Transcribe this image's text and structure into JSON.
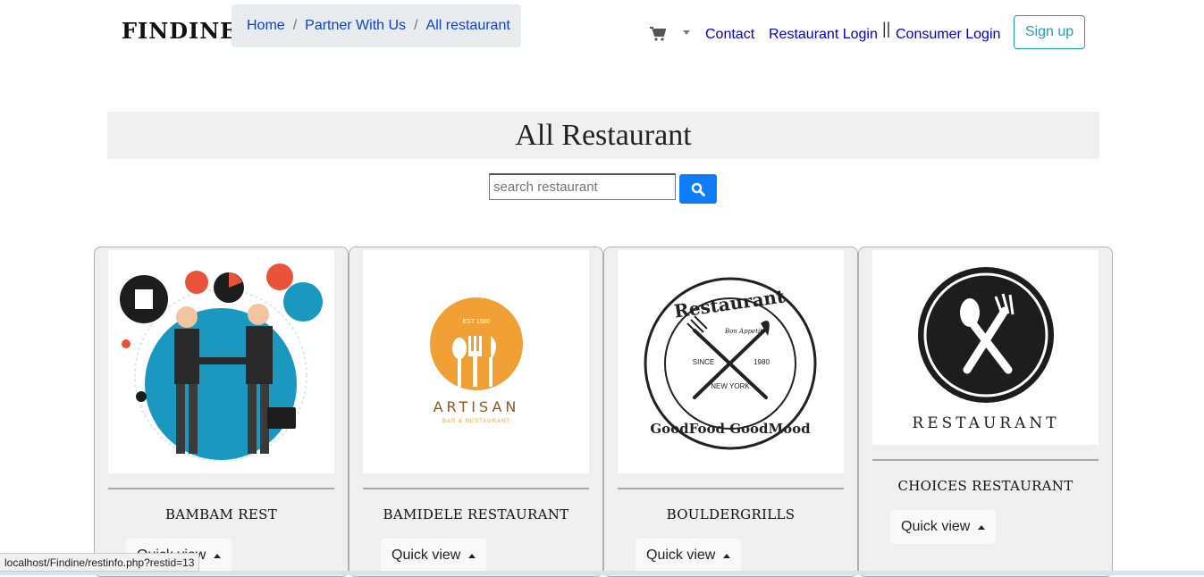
{
  "brand": "FINDINE",
  "breadcrumb": [
    "Home",
    "Partner With Us",
    "All restaurant"
  ],
  "nav": {
    "contact": "Contact",
    "restaurant_login": "Restaurant Login",
    "separator": "||",
    "consumer_login": "Consumer Login",
    "signup": "Sign up",
    "cart_icon": "cart-icon"
  },
  "page_title": "All Restaurant",
  "search": {
    "placeholder": "search restaurant",
    "icon": "search-icon"
  },
  "restaurants": [
    {
      "name": "Bambam Rest",
      "button": "Quick view"
    },
    {
      "name": "Bamidele Restaurant",
      "button": "Quick view",
      "logo_text": "ARTISAN",
      "logo_sub": "BAR & RESTAURANT",
      "logo_est": "EST 1980"
    },
    {
      "name": "Bouldergrills",
      "button": "Quick view",
      "logo_top": "Restaurant",
      "logo_bottom": "GoodFood GoodMood",
      "logo_since": "SINCE",
      "logo_year": "1980",
      "logo_city": "NEW YORK",
      "logo_tag": "Bon Appetit"
    },
    {
      "name": "Choices Restaurant",
      "button": "Quick view",
      "logo_text": "RESTAURANT"
    }
  ],
  "status_url": "localhost/Findine/restinfo.php?restid=13",
  "colors": {
    "link": "#0000cc",
    "breadcrumb_link": "#0d3fd6",
    "signup": "#17a2b8",
    "search_button": "#0d7df9",
    "card_bg": "#efefef"
  }
}
